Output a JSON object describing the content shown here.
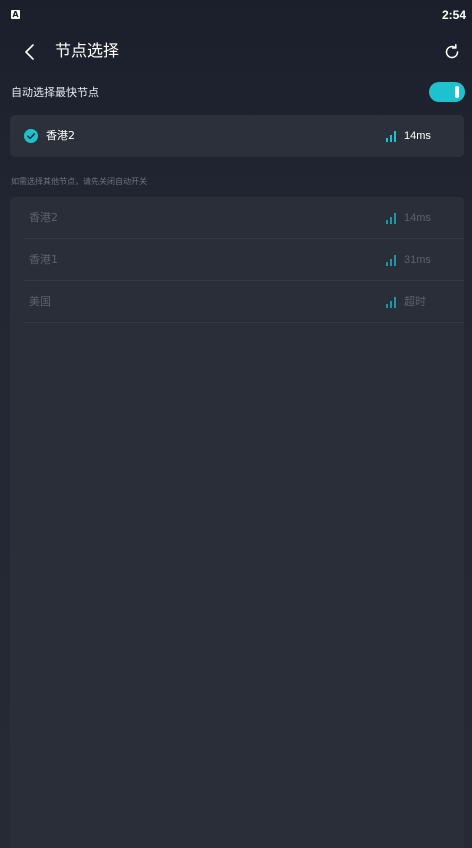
{
  "status_bar": {
    "app_icon_letter": "A",
    "time": "2:54"
  },
  "header": {
    "title": "节点选择"
  },
  "auto_select": {
    "label": "自动选择最快节点",
    "enabled": true
  },
  "selected_node": {
    "name": "香港2",
    "latency": "14ms"
  },
  "hint": "如需选择其他节点，请先关闭自动开关",
  "node_list": [
    {
      "name": "香港2",
      "latency": "14ms"
    },
    {
      "name": "香港1",
      "latency": "31ms"
    },
    {
      "name": "美国",
      "latency": "超时"
    }
  ],
  "colors": {
    "accent": "#1ec2cf",
    "background": "#262a35",
    "card": "#2c303b",
    "disabled_text": "#5c616d"
  }
}
